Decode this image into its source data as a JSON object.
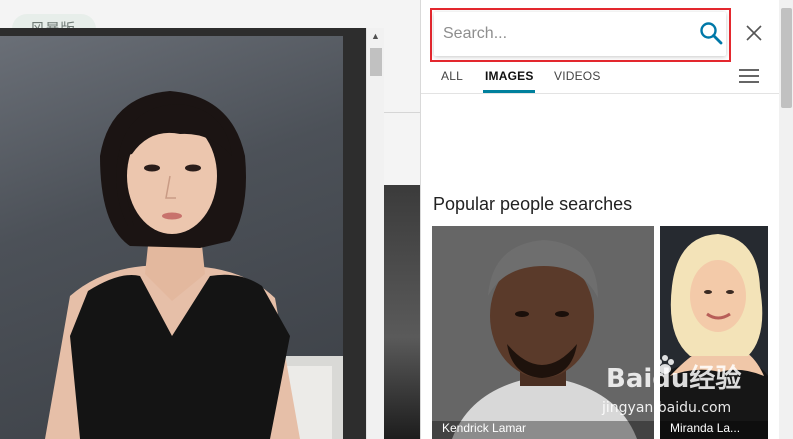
{
  "background_page": {
    "pill_label": "风暴版"
  },
  "viewer": {
    "scroll_up_glyph": "▲"
  },
  "search": {
    "placeholder": "Search..."
  },
  "tabs": [
    {
      "label": "ALL",
      "active": false
    },
    {
      "label": "IMAGES",
      "active": true
    },
    {
      "label": "VIDEOS",
      "active": false
    }
  ],
  "section": {
    "title": "Popular people searches"
  },
  "people": [
    {
      "name": "Kendrick Lamar"
    },
    {
      "name": "Miranda La..."
    }
  ],
  "watermark": {
    "brand": "Baidu经验",
    "domain": "jingyan.baidu.com"
  },
  "colors": {
    "accent": "#00809d",
    "highlight_border": "#e4282f",
    "search_icon": "#0078a8"
  },
  "icons": {
    "search": "search-icon",
    "close": "close-icon",
    "menu": "hamburger-menu-icon"
  }
}
